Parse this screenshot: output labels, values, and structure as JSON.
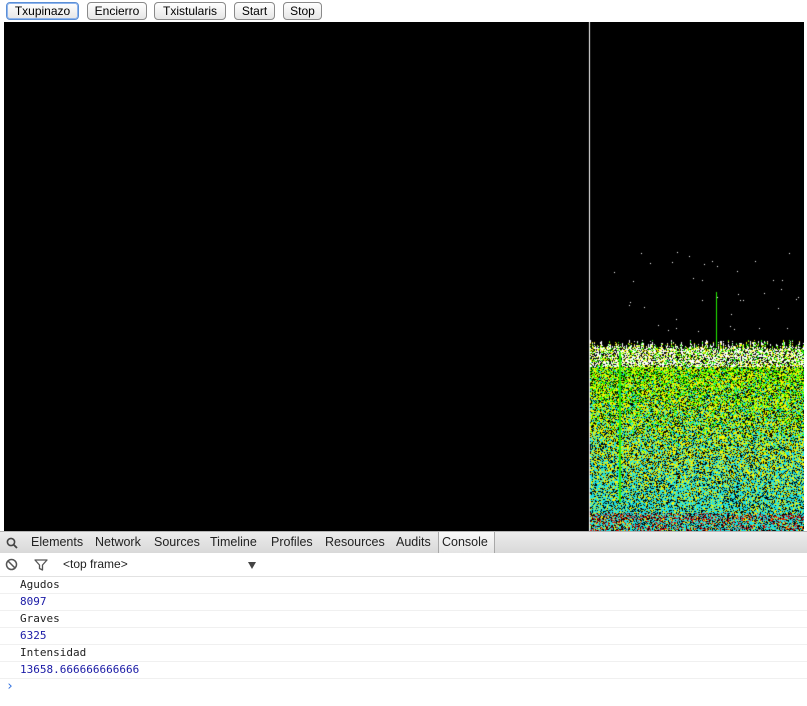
{
  "buttons": {
    "txupinazo": "Txupinazo",
    "encierro": "Encierro",
    "txistularis": "Txistularis",
    "start": "Start",
    "stop": "Stop"
  },
  "spectrogram": {
    "background": "#000000",
    "colors": {
      "white": "#ffffff",
      "green": "#22ee00",
      "yellow": "#f3f300",
      "cyan": "#20e0e0",
      "red": "#d01010"
    }
  },
  "devtools": {
    "tabs": [
      "Elements",
      "Network",
      "Sources",
      "Timeline",
      "Profiles",
      "Resources",
      "Audits",
      "Console"
    ],
    "active_tab": "Console",
    "frame_select": "<top frame>",
    "console_lines": [
      {
        "text": "Agudos",
        "kind": "text"
      },
      {
        "text": "8097",
        "kind": "num"
      },
      {
        "text": "Graves",
        "kind": "text"
      },
      {
        "text": "6325",
        "kind": "num"
      },
      {
        "text": "Intensidad",
        "kind": "text"
      },
      {
        "text": "13658.666666666666",
        "kind": "num"
      }
    ],
    "prompt": "›",
    "icons": [
      "search-icon",
      "clear-console-icon",
      "filter-icon",
      "dropdown-arrow-icon"
    ]
  }
}
